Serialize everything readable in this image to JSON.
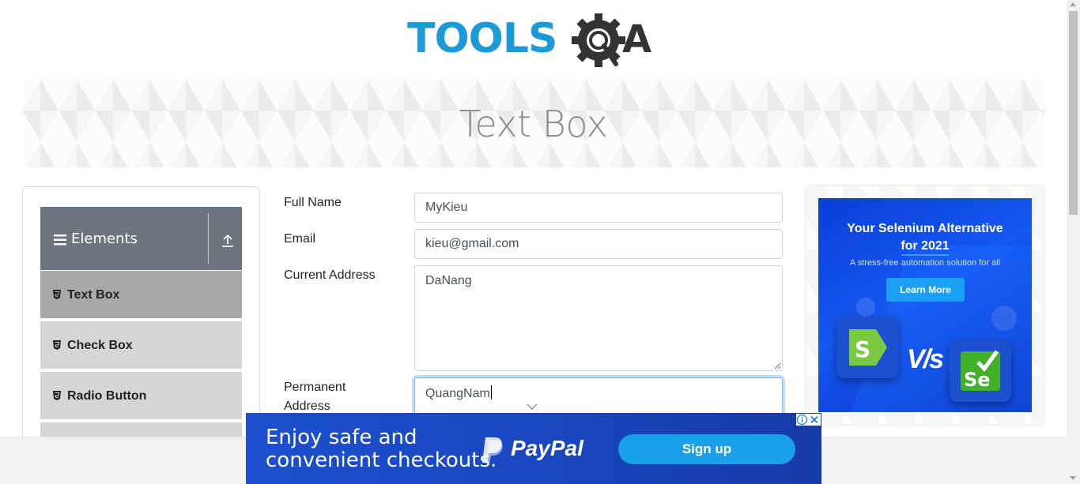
{
  "header": {
    "logo_text_left": "TOOLS",
    "logo_text_right": "QA"
  },
  "banner": {
    "title": "Text Box"
  },
  "sidebar": {
    "group_title": "Elements",
    "items": [
      {
        "label": "Text Box",
        "active": true
      },
      {
        "label": "Check Box",
        "active": false
      },
      {
        "label": "Radio Button",
        "active": false
      }
    ]
  },
  "form": {
    "full_name": {
      "label": "Full Name",
      "value": "MyKieu"
    },
    "email": {
      "label": "Email",
      "value": "kieu@gmail.com"
    },
    "current_address": {
      "label": "Current Address",
      "value": "DaNang"
    },
    "permanent_address": {
      "label_line1": "Permanent",
      "label_line2": "Address",
      "value": "QuangNam"
    }
  },
  "side_ad": {
    "headline_line1": "Your Selenium Alternative",
    "headline_line2": "for 2021",
    "subtext": "A stress-free automation solution for all",
    "button_label": "Learn More",
    "vs_text": "V/s",
    "logo_left_letter": "S",
    "logo_right_text": "Se"
  },
  "bottom_ad": {
    "line1": "Enjoy safe and",
    "line2": "convenient checkouts.",
    "brand": "PayPal",
    "button_label": "Sign up"
  },
  "colors": {
    "logo_blue": "#1b9ad6",
    "logo_dark": "#333333",
    "sidebar_header": "#6c757d",
    "active_item": "#a8a8a8",
    "ad_blue": "#1d4fcf"
  }
}
